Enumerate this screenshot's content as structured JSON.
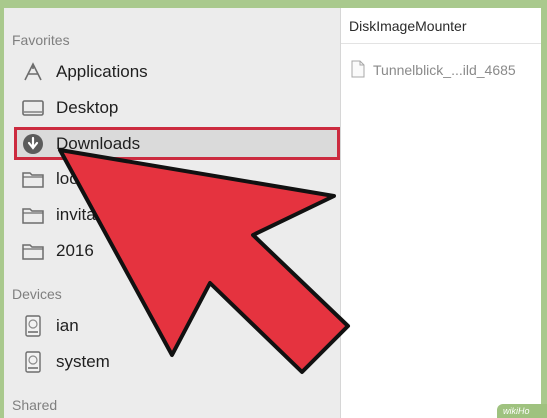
{
  "sidebar": {
    "favorites_title": "Favorites",
    "devices_title": "Devices",
    "shared_title": "Shared",
    "favorites": [
      {
        "label": "Applications",
        "icon": "applications-icon"
      },
      {
        "label": "Desktop",
        "icon": "desktop-icon"
      },
      {
        "label": "Downloads",
        "icon": "downloads-icon",
        "selected": true
      },
      {
        "label": "loor",
        "icon": "folder-icon"
      },
      {
        "label": "invitat",
        "icon": "folder-icon"
      },
      {
        "label": "2016",
        "icon": "folder-icon"
      }
    ],
    "devices": [
      {
        "label": "ian",
        "icon": "disk-icon"
      },
      {
        "label": "system",
        "icon": "disk-icon"
      }
    ]
  },
  "column": {
    "header": "DiskImageMounter",
    "file": "Tunnelblick_...ild_4685"
  },
  "watermark": "wikiHo",
  "colors": {
    "frame": "#a9c98d",
    "highlight": "#cc2b3f",
    "arrow": "#e5333f",
    "sidebar_bg": "#ececec"
  }
}
